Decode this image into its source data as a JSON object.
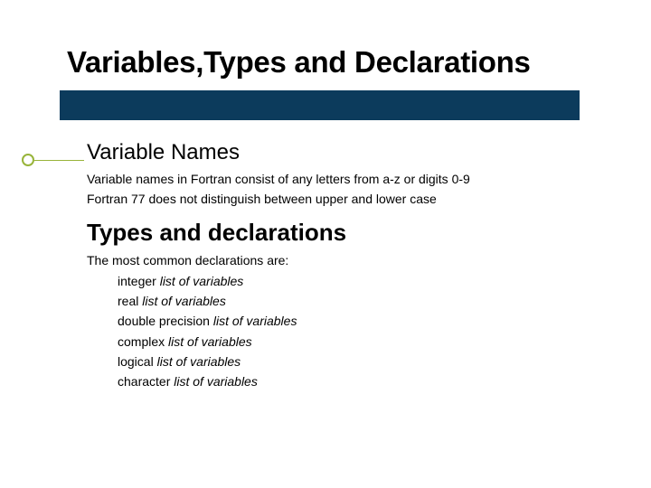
{
  "title": "Variables,Types and Declarations",
  "section1": {
    "heading": "Variable Names",
    "line1": "Variable names in Fortran consist of any letters from a-z or digits 0-9",
    "line2": "Fortran 77 does not distinguish between upper and lower case"
  },
  "section2": {
    "heading": "Types and declarations",
    "intro": "The most common declarations are:",
    "declarations": [
      {
        "keyword": "integer ",
        "arg": "list of variables"
      },
      {
        "keyword": "real ",
        "arg": "list of variables"
      },
      {
        "keyword": "double precision ",
        "arg": "list of variables"
      },
      {
        "keyword": "complex ",
        "arg": "list of variables"
      },
      {
        "keyword": "logical ",
        "arg": "list of variables"
      },
      {
        "keyword": "character ",
        "arg": "list of variables"
      }
    ]
  }
}
